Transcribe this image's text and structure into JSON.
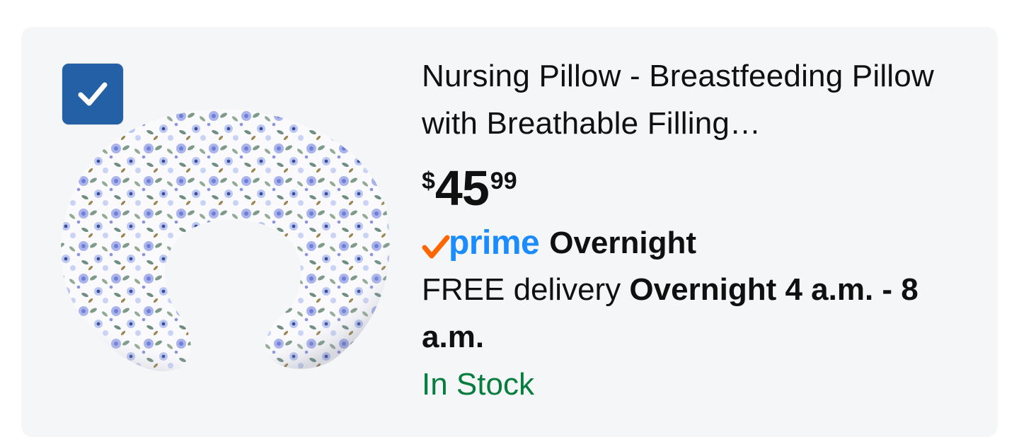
{
  "product": {
    "title": "Nursing Pillow - Breastfeeding Pillow with Breathable Filling…",
    "selected": true,
    "price": {
      "symbol": "$",
      "whole": "45",
      "fraction": "99"
    },
    "prime": {
      "logo_text": "prime",
      "tier": "Overnight"
    },
    "delivery": {
      "prefix": "FREE delivery",
      "window": "Overnight 4 a.m. - 8 a.m."
    },
    "stock": "In Stock"
  },
  "colors": {
    "card_bg": "#f5f6f8",
    "checkbox": "#2460a6",
    "prime_blue": "#1a8cff",
    "prime_check": "#ff6600",
    "in_stock": "#067d3c"
  },
  "icons": {
    "checkbox": "checkmark-icon",
    "prime": "prime-check-icon"
  }
}
